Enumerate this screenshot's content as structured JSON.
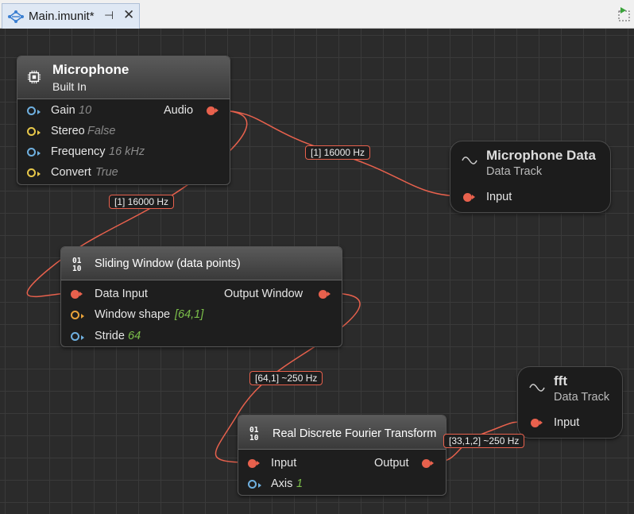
{
  "tab": {
    "title": "Main.imunit*",
    "pin_glyph": "⊣",
    "close_glyph": "✕",
    "icon": "graph-network-icon"
  },
  "nodes": {
    "microphone": {
      "title": "Microphone",
      "subtitle": "Built In",
      "icon": "chip-icon",
      "inputs": [
        {
          "label": "Gain",
          "value": "10",
          "pin": "blue"
        },
        {
          "label": "Stereo",
          "value": "False",
          "pin": "yellow"
        },
        {
          "label": "Frequency",
          "value": "16 kHz",
          "pin": "blue"
        },
        {
          "label": "Convert",
          "value": "True",
          "pin": "yellow"
        }
      ],
      "output": "Audio"
    },
    "mic_data": {
      "title": "Microphone Data",
      "subtitle": "Data Track",
      "input": "Input",
      "icon": "wave-icon"
    },
    "sliding_window": {
      "title": "Sliding Window (data points)",
      "icon": "binary-icon",
      "icon_text": "01\n10",
      "inputs": [
        {
          "label": "Data Input",
          "value": "",
          "pin": "red"
        },
        {
          "label": "Window shape",
          "value": "[64,1]",
          "pin": "orange"
        },
        {
          "label": "Stride",
          "value": "64",
          "pin": "blue"
        }
      ],
      "output": "Output Window"
    },
    "fft_track": {
      "title": "fft",
      "subtitle": "Data Track",
      "input": "Input",
      "icon": "wave-icon"
    },
    "rdft": {
      "title": "Real Discrete Fourier Transform",
      "icon": "binary-icon",
      "inputs": [
        {
          "label": "Input",
          "value": "",
          "pin": "red"
        },
        {
          "label": "Axis",
          "value": "1",
          "pin": "blue"
        }
      ],
      "output": "Output"
    }
  },
  "wire_labels": {
    "audio_to_track": "[1] 16000 Hz",
    "audio_to_window": "[1] 16000 Hz",
    "window_to_rdft": "[64,1] ~250 Hz",
    "rdft_to_fft": "[33,1,2] ~250 Hz"
  },
  "colors": {
    "wire": "#e8614d",
    "value_grey": "#8a8a8a",
    "value_green": "#7cc04a"
  }
}
